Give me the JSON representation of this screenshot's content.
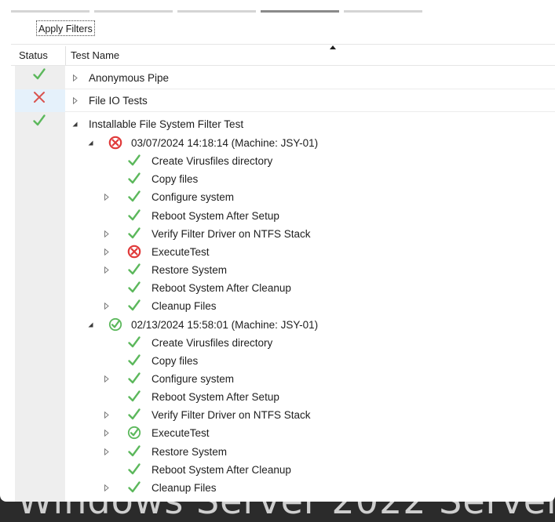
{
  "toolbar": {
    "apply_filters_label": "Apply Filters"
  },
  "columns": {
    "status": "Status",
    "test_name": "Test Name"
  },
  "tree": [
    {
      "label": "Anonymous Pipe",
      "status": "pass",
      "expander": "collapsed"
    },
    {
      "label": "File IO Tests",
      "status": "fail",
      "expander": "collapsed"
    },
    {
      "label": "Installable File System Filter Test",
      "status": "pass",
      "expander": "expanded"
    },
    {
      "label": "03/07/2024 14:18:14 (Machine: JSY-01)",
      "status": "error-circle",
      "expander": "expanded"
    },
    {
      "label": "Create Virusfiles directory",
      "status": "check",
      "expander": "none"
    },
    {
      "label": "Copy files",
      "status": "check",
      "expander": "none"
    },
    {
      "label": "Configure system",
      "status": "check",
      "expander": "collapsed"
    },
    {
      "label": "Reboot System After Setup",
      "status": "check",
      "expander": "none"
    },
    {
      "label": "Verify Filter Driver on NTFS Stack",
      "status": "check",
      "expander": "collapsed"
    },
    {
      "label": "ExecuteTest",
      "status": "error-circle",
      "expander": "collapsed"
    },
    {
      "label": "Restore System",
      "status": "check",
      "expander": "collapsed"
    },
    {
      "label": "Reboot System After Cleanup",
      "status": "check",
      "expander": "none"
    },
    {
      "label": "Cleanup Files",
      "status": "check",
      "expander": "collapsed"
    },
    {
      "label": "02/13/2024 15:58:01 (Machine: JSY-01)",
      "status": "pass-circle",
      "expander": "expanded"
    },
    {
      "label": "Create Virusfiles directory",
      "status": "check",
      "expander": "none"
    },
    {
      "label": "Copy files",
      "status": "check",
      "expander": "none"
    },
    {
      "label": "Configure system",
      "status": "check",
      "expander": "collapsed"
    },
    {
      "label": "Reboot System After Setup",
      "status": "check",
      "expander": "none"
    },
    {
      "label": "Verify Filter Driver on NTFS Stack",
      "status": "check",
      "expander": "collapsed"
    },
    {
      "label": "ExecuteTest",
      "status": "pass-circle",
      "expander": "collapsed"
    },
    {
      "label": "Restore System",
      "status": "check",
      "expander": "collapsed"
    },
    {
      "label": "Reboot System After Cleanup",
      "status": "check",
      "expander": "none"
    },
    {
      "label": "Cleanup Files",
      "status": "check",
      "expander": "collapsed"
    }
  ],
  "colors": {
    "pass": "#5cb85c",
    "fail": "#d9534f",
    "selected_row": "#e5f1fb",
    "status_column": "#eeeeee"
  }
}
